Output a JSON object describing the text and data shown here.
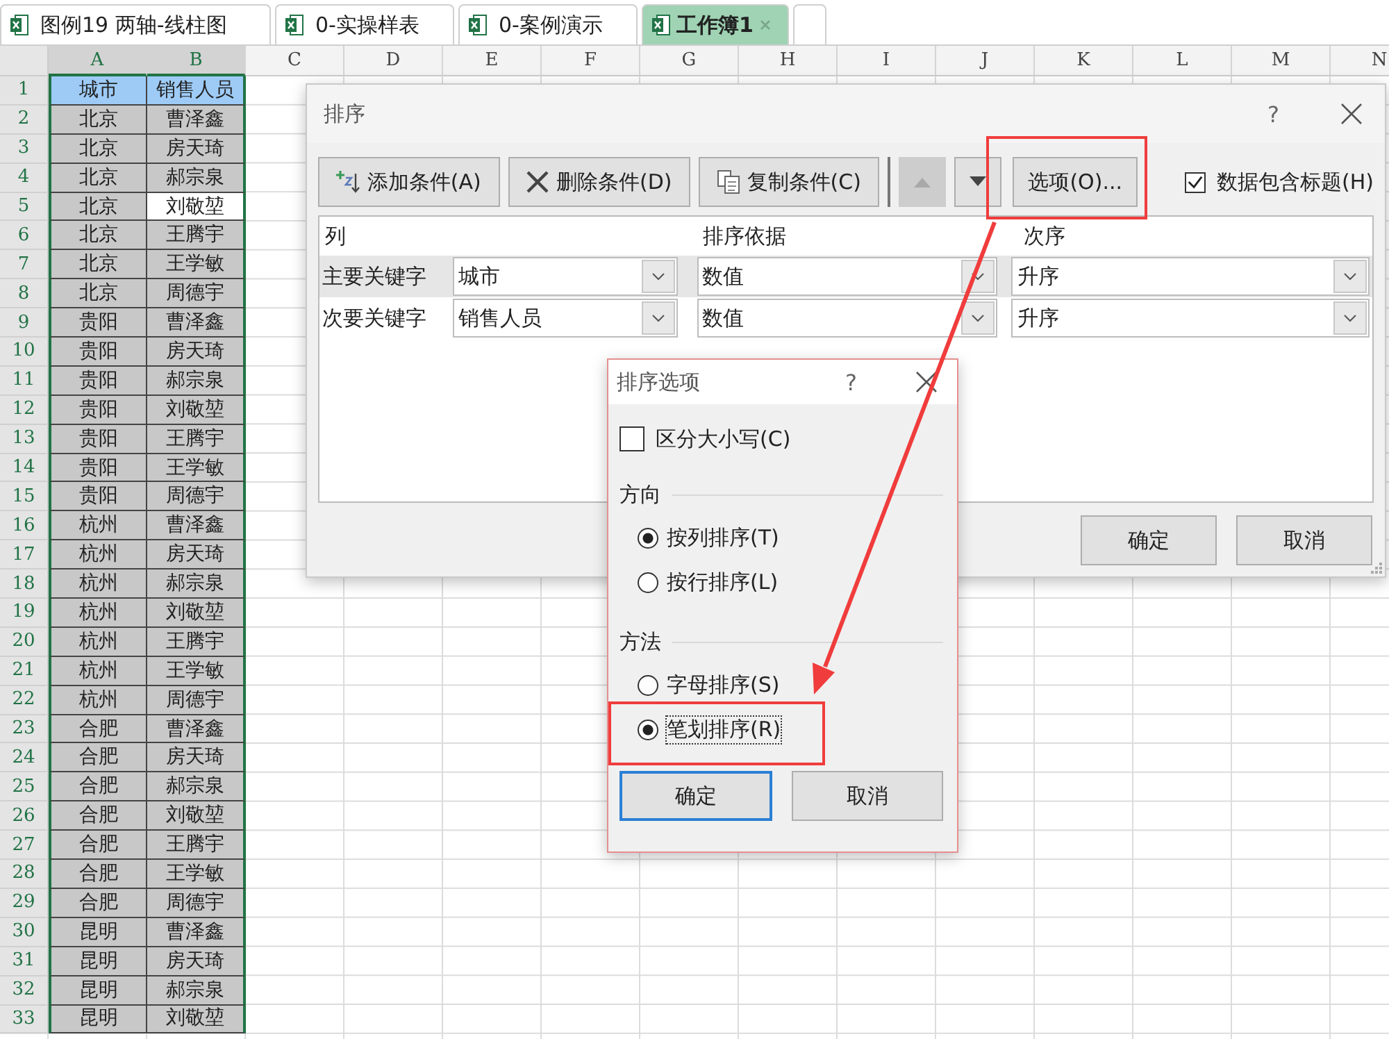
{
  "tabs": [
    {
      "label": "图例19  两轴-线柱图",
      "selected": false
    },
    {
      "label": "0-实操样表",
      "selected": false
    },
    {
      "label": "0-案例演示",
      "selected": false
    },
    {
      "label": "工作簿1",
      "selected": true
    }
  ],
  "columns": [
    {
      "label": "A",
      "selected": true
    },
    {
      "label": "B",
      "selected": true
    },
    {
      "label": "C",
      "selected": false
    },
    {
      "label": "D",
      "selected": false
    },
    {
      "label": "E",
      "selected": false
    },
    {
      "label": "F",
      "selected": false
    },
    {
      "label": "G",
      "selected": false
    },
    {
      "label": "H",
      "selected": false
    },
    {
      "label": "I",
      "selected": false
    },
    {
      "label": "J",
      "selected": false
    },
    {
      "label": "K",
      "selected": false
    },
    {
      "label": "L",
      "selected": false
    },
    {
      "label": "M",
      "selected": false
    },
    {
      "label": "N",
      "selected": false
    }
  ],
  "rows": [
    {
      "number": "1",
      "kind": "header",
      "cells": [
        {
          "text": "城市",
          "selected": false
        },
        {
          "text": "销售人员",
          "selected": false
        }
      ]
    },
    {
      "number": "2",
      "kind": "data",
      "cells": [
        {
          "text": "北京",
          "selected": false
        },
        {
          "text": "曹泽鑫",
          "selected": false
        }
      ]
    },
    {
      "number": "3",
      "kind": "data",
      "cells": [
        {
          "text": "北京",
          "selected": false
        },
        {
          "text": "房天琦",
          "selected": false
        }
      ]
    },
    {
      "number": "4",
      "kind": "data",
      "cells": [
        {
          "text": "北京",
          "selected": false
        },
        {
          "text": "郝宗泉",
          "selected": false
        }
      ]
    },
    {
      "number": "5",
      "kind": "data",
      "cells": [
        {
          "text": "北京",
          "selected": false
        },
        {
          "text": "刘敬堃",
          "selected": true
        }
      ]
    },
    {
      "number": "6",
      "kind": "data",
      "cells": [
        {
          "text": "北京",
          "selected": false
        },
        {
          "text": "王腾宇",
          "selected": false
        }
      ]
    },
    {
      "number": "7",
      "kind": "data",
      "cells": [
        {
          "text": "北京",
          "selected": false
        },
        {
          "text": "王学敏",
          "selected": false
        }
      ]
    },
    {
      "number": "8",
      "kind": "data",
      "cells": [
        {
          "text": "北京",
          "selected": false
        },
        {
          "text": "周德宇",
          "selected": false
        }
      ]
    },
    {
      "number": "9",
      "kind": "data",
      "cells": [
        {
          "text": "贵阳",
          "selected": false
        },
        {
          "text": "曹泽鑫",
          "selected": false
        }
      ]
    },
    {
      "number": "10",
      "kind": "data",
      "cells": [
        {
          "text": "贵阳",
          "selected": false
        },
        {
          "text": "房天琦",
          "selected": false
        }
      ]
    },
    {
      "number": "11",
      "kind": "data",
      "cells": [
        {
          "text": "贵阳",
          "selected": false
        },
        {
          "text": "郝宗泉",
          "selected": false
        }
      ]
    },
    {
      "number": "12",
      "kind": "data",
      "cells": [
        {
          "text": "贵阳",
          "selected": false
        },
        {
          "text": "刘敬堃",
          "selected": false
        }
      ]
    },
    {
      "number": "13",
      "kind": "data",
      "cells": [
        {
          "text": "贵阳",
          "selected": false
        },
        {
          "text": "王腾宇",
          "selected": false
        }
      ]
    },
    {
      "number": "14",
      "kind": "data",
      "cells": [
        {
          "text": "贵阳",
          "selected": false
        },
        {
          "text": "王学敏",
          "selected": false
        }
      ]
    },
    {
      "number": "15",
      "kind": "data",
      "cells": [
        {
          "text": "贵阳",
          "selected": false
        },
        {
          "text": "周德宇",
          "selected": false
        }
      ]
    },
    {
      "number": "16",
      "kind": "data",
      "cells": [
        {
          "text": "杭州",
          "selected": false
        },
        {
          "text": "曹泽鑫",
          "selected": false
        }
      ]
    },
    {
      "number": "17",
      "kind": "data",
      "cells": [
        {
          "text": "杭州",
          "selected": false
        },
        {
          "text": "房天琦",
          "selected": false
        }
      ]
    },
    {
      "number": "18",
      "kind": "data",
      "cells": [
        {
          "text": "杭州",
          "selected": false
        },
        {
          "text": "郝宗泉",
          "selected": false
        }
      ]
    },
    {
      "number": "19",
      "kind": "data",
      "cells": [
        {
          "text": "杭州",
          "selected": false
        },
        {
          "text": "刘敬堃",
          "selected": false
        }
      ]
    },
    {
      "number": "20",
      "kind": "data",
      "cells": [
        {
          "text": "杭州",
          "selected": false
        },
        {
          "text": "王腾宇",
          "selected": false
        }
      ]
    },
    {
      "number": "21",
      "kind": "data",
      "cells": [
        {
          "text": "杭州",
          "selected": false
        },
        {
          "text": "王学敏",
          "selected": false
        }
      ]
    },
    {
      "number": "22",
      "kind": "data",
      "cells": [
        {
          "text": "杭州",
          "selected": false
        },
        {
          "text": "周德宇",
          "selected": false
        }
      ]
    },
    {
      "number": "23",
      "kind": "data",
      "cells": [
        {
          "text": "合肥",
          "selected": false
        },
        {
          "text": "曹泽鑫",
          "selected": false
        }
      ]
    },
    {
      "number": "24",
      "kind": "data",
      "cells": [
        {
          "text": "合肥",
          "selected": false
        },
        {
          "text": "房天琦",
          "selected": false
        }
      ]
    },
    {
      "number": "25",
      "kind": "data",
      "cells": [
        {
          "text": "合肥",
          "selected": false
        },
        {
          "text": "郝宗泉",
          "selected": false
        }
      ]
    },
    {
      "number": "26",
      "kind": "data",
      "cells": [
        {
          "text": "合肥",
          "selected": false
        },
        {
          "text": "刘敬堃",
          "selected": false
        }
      ]
    },
    {
      "number": "27",
      "kind": "data",
      "cells": [
        {
          "text": "合肥",
          "selected": false
        },
        {
          "text": "王腾宇",
          "selected": false
        }
      ]
    },
    {
      "number": "28",
      "kind": "data",
      "cells": [
        {
          "text": "合肥",
          "selected": false
        },
        {
          "text": "王学敏",
          "selected": false
        }
      ]
    },
    {
      "number": "29",
      "kind": "data",
      "cells": [
        {
          "text": "合肥",
          "selected": false
        },
        {
          "text": "周德宇",
          "selected": false
        }
      ]
    },
    {
      "number": "30",
      "kind": "data",
      "cells": [
        {
          "text": "昆明",
          "selected": false
        },
        {
          "text": "曹泽鑫",
          "selected": false
        }
      ]
    },
    {
      "number": "31",
      "kind": "data",
      "cells": [
        {
          "text": "昆明",
          "selected": false
        },
        {
          "text": "房天琦",
          "selected": false
        }
      ]
    },
    {
      "number": "32",
      "kind": "data",
      "cells": [
        {
          "text": "昆明",
          "selected": false
        },
        {
          "text": "郝宗泉",
          "selected": false
        }
      ]
    },
    {
      "number": "33",
      "kind": "data",
      "cells": [
        {
          "text": "昆明",
          "selected": false
        },
        {
          "text": "刘敬堃",
          "selected": false
        }
      ]
    }
  ],
  "sort_dialog": {
    "title": "排序",
    "help": "?",
    "toolbar": {
      "add": "添加条件(A)",
      "delete": "删除条件(D)",
      "copy": "复制条件(C)",
      "move_up_disabled": true,
      "options": "选项(O)...",
      "has_headers": {
        "label": "数据包含标题(H)",
        "checked": true
      }
    },
    "headers": [
      "列",
      "排序依据",
      "次序"
    ],
    "conditions": [
      {
        "label": "主要关键字",
        "column": "城市",
        "basis": "数值",
        "order": "升序",
        "selected": true
      },
      {
        "label": "次要关键字",
        "column": "销售人员",
        "basis": "数值",
        "order": "升序",
        "selected": false
      }
    ],
    "ok": "确定",
    "cancel": "取消"
  },
  "options_dialog": {
    "title": "排序选项",
    "help": "?",
    "case_sensitive": {
      "label": "区分大小写(C)",
      "checked": false
    },
    "groups": [
      {
        "title": "方向",
        "options": [
          {
            "label": "按列排序(T)",
            "selected": true
          },
          {
            "label": "按行排序(L)",
            "selected": false
          }
        ]
      },
      {
        "title": "方法",
        "options": [
          {
            "label": "字母排序(S)",
            "selected": false
          },
          {
            "label": "笔划排序(R)",
            "selected": true
          }
        ]
      }
    ],
    "ok": "确定",
    "cancel": "取消"
  }
}
